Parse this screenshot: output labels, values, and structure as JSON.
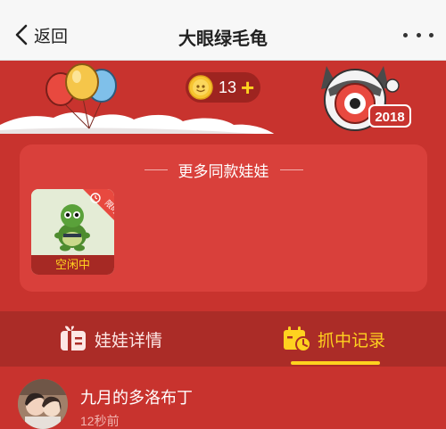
{
  "nav": {
    "back_label": "返回",
    "title": "大眼绿毛龟"
  },
  "banner": {
    "coin_count": "13",
    "coin_plus": "+",
    "mascot_year": "2018"
  },
  "more_dolls": {
    "title": "更多同款娃娃",
    "items": [
      {
        "status": "空闲中",
        "badge": "限时抢"
      }
    ]
  },
  "tabs": [
    {
      "label": "娃娃详情",
      "active": false
    },
    {
      "label": "抓中记录",
      "active": true
    }
  ],
  "records": [
    {
      "user_name": "九月的多洛布丁",
      "time": "12秒前"
    }
  ],
  "colors": {
    "background": "#c8332e",
    "card": "#d9403b",
    "tab_bar": "#ab2c27",
    "accent": "#ffd21f"
  }
}
